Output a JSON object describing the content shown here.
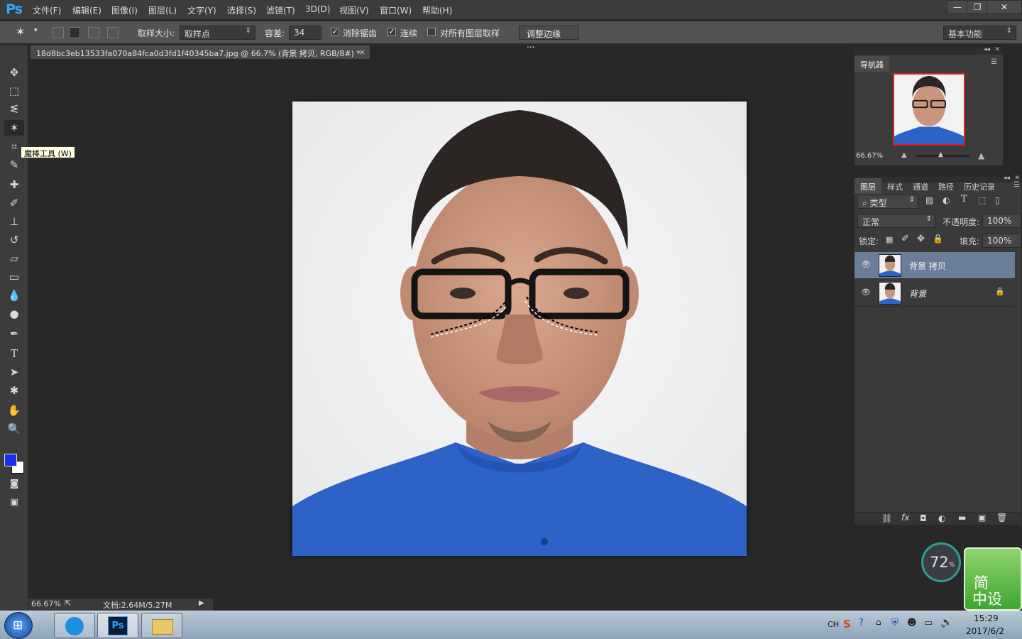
{
  "app": {
    "logo": "Ps"
  },
  "menu": [
    "文件(F)",
    "编辑(E)",
    "图像(I)",
    "图层(L)",
    "文字(Y)",
    "选择(S)",
    "滤镜(T)",
    "3D(D)",
    "视图(V)",
    "窗口(W)",
    "帮助(H)"
  ],
  "window_controls": {
    "minimize": "—",
    "restore": "❐",
    "close": "✕"
  },
  "options": {
    "sample_size_label": "取样大小:",
    "sample_size_value": "取样点",
    "tolerance_label": "容差:",
    "tolerance_value": "34",
    "anti_alias_label": "消除锯齿",
    "anti_alias_checked": true,
    "contiguous_label": "连续",
    "contiguous_checked": true,
    "sample_all_label": "对所有图层取样",
    "sample_all_checked": false,
    "refine_edge_label": "调整边缘 ...",
    "workspace_value": "基本功能"
  },
  "document": {
    "tab_title": "18d8bc3eb13533fa070a84fca0d3fd1f40345ba7.jpg @ 66.7% (背景 拷贝, RGB/8#) *",
    "close": "×"
  },
  "tooltip": "魔棒工具 (W)",
  "colors": {
    "foreground": "#1b2ff0",
    "background": "#ffffff",
    "accent": "#31a8ff",
    "selected_layer": "#6a7d99"
  },
  "tools": [
    "move-icon",
    "marquee-icon",
    "lasso-icon",
    "magic-wand-icon",
    "crop-icon",
    "eyedropper-icon",
    "healing-brush-icon",
    "brush-icon",
    "clone-stamp-icon",
    "history-brush-icon",
    "eraser-icon",
    "gradient-icon",
    "blur-icon",
    "dodge-icon",
    "pen-icon",
    "type-icon",
    "path-select-icon",
    "shape-icon",
    "hand-icon",
    "zoom-icon"
  ],
  "status": {
    "zoom": "66.67%",
    "doc_size": "文档:2.64M/5.27M"
  },
  "navigator": {
    "tab": "导航器",
    "zoom": "66.67%"
  },
  "layers_panel": {
    "tabs": [
      "图层",
      "样式",
      "通道",
      "路径",
      "历史记录"
    ],
    "filter_label": "类型",
    "blend_mode": "正常",
    "opacity_label": "不透明度:",
    "opacity_value": "100%",
    "lock_label": "锁定:",
    "fill_label": "填充:",
    "fill_value": "100%",
    "layers": [
      {
        "name": "背景 拷贝",
        "selected": true,
        "locked": false
      },
      {
        "name": "背景",
        "selected": false,
        "locked": true
      }
    ]
  },
  "widget": {
    "percent": "72",
    "unit": "%",
    "badge_line1": "简",
    "badge_line2": "中设"
  },
  "taskbar": {
    "lang": "CH",
    "time": "15:29",
    "date": "2017/6/2",
    "ps_label": "Ps"
  }
}
